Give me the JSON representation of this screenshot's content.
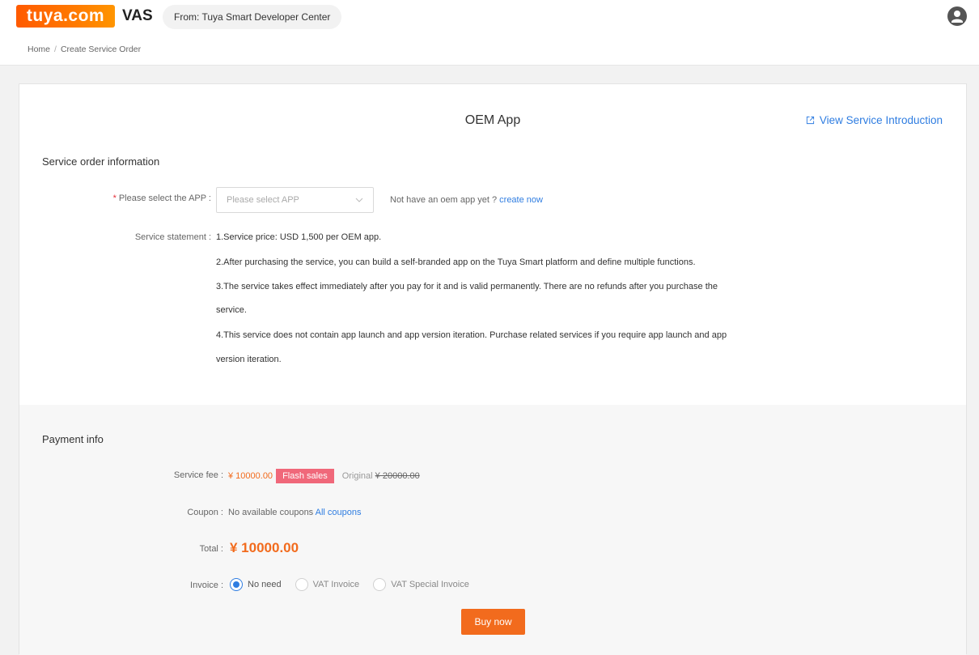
{
  "header": {
    "logo_text": "tuya.com",
    "product": "VAS",
    "from_label": "From:",
    "from_value": "Tuya Smart Developer Center",
    "avatar_icon": "user-avatar-icon"
  },
  "breadcrumb": {
    "home": "Home",
    "separator": "/",
    "current": "Create Service Order"
  },
  "page": {
    "title": "OEM App",
    "view_link": "View Service Introduction",
    "view_link_icon": "external-link-icon"
  },
  "order_info": {
    "section_title": "Service order information",
    "select_app": {
      "required_mark": "*",
      "label": "Please select the APP :",
      "placeholder": "Please select APP",
      "hint": "Not have an oem app yet ?",
      "create_link": "create now"
    },
    "statement": {
      "label": "Service statement :",
      "lines": [
        "1.Service price: USD 1,500 per OEM app.",
        "2.After purchasing the service, you can build a self-branded app on the Tuya Smart platform and define multiple functions.",
        "3.The service takes effect immediately after you pay for it and is valid permanently. There are no refunds after you purchase the",
        "service.",
        "4.This service does not contain app launch and app version iteration. Purchase related services if you require app launch and app",
        "version iteration."
      ]
    }
  },
  "payment": {
    "section_title": "Payment info",
    "service_fee": {
      "label": "Service fee :",
      "value": "¥ 10000.00",
      "badge": "Flash sales",
      "original_label": "Original",
      "original_value": "¥ 20000.00"
    },
    "coupon": {
      "label": "Coupon :",
      "value": "No available coupons",
      "link": "All coupons"
    },
    "total": {
      "label": "Total :",
      "value": "¥ 10000.00"
    },
    "invoice": {
      "label": "Invoice :",
      "options": [
        {
          "label": "No need",
          "selected": true
        },
        {
          "label": "VAT Invoice",
          "selected": false
        },
        {
          "label": "VAT Special Invoice",
          "selected": false
        }
      ]
    },
    "buy_button": "Buy now"
  },
  "colors": {
    "accent_orange": "#f26b1d",
    "link_blue": "#2f7de1",
    "flash_badge": "#f0687a"
  }
}
